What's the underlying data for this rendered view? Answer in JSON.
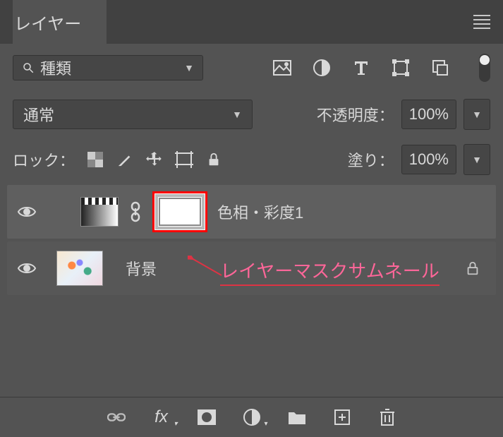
{
  "panel": {
    "title": "レイヤー"
  },
  "filter": {
    "selected": "種類",
    "icons": [
      "image",
      "adjustment",
      "type",
      "shape",
      "smartobject"
    ]
  },
  "blend": {
    "mode": "通常",
    "opacity_label": "不透明度：",
    "opacity_value": "100%"
  },
  "lock": {
    "label": "ロック：",
    "fill_label": "塗り：",
    "fill_value": "100%"
  },
  "layers": [
    {
      "name": "色相・彩度1",
      "type": "adjustment",
      "selected": true,
      "visible": true
    },
    {
      "name": "背景",
      "type": "background",
      "locked": true,
      "visible": true
    }
  ],
  "annotation": {
    "text": "レイヤーマスクサムネール"
  },
  "bottom_icons": [
    "link",
    "fx",
    "mask",
    "adjustment",
    "group",
    "new",
    "delete"
  ]
}
